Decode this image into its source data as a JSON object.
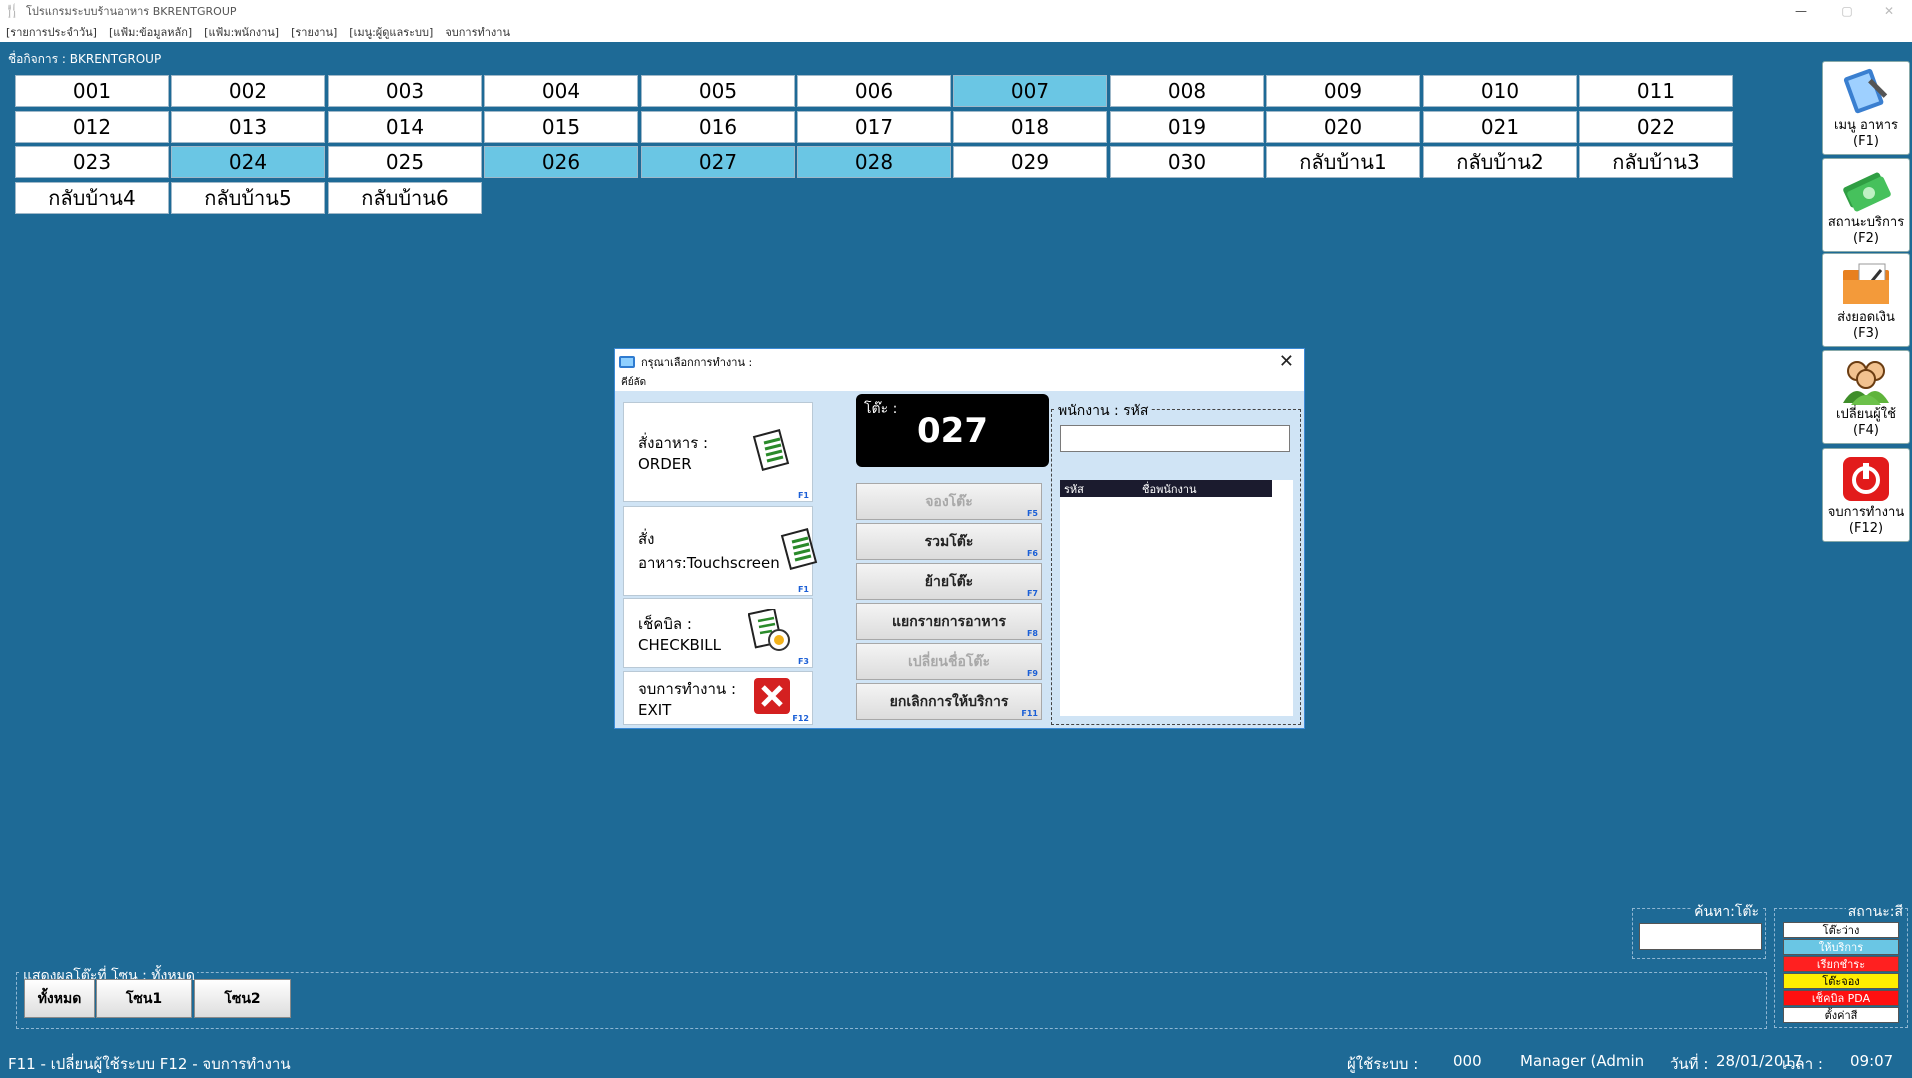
{
  "window": {
    "title": "โปรแกรมระบบร้านอาหาร  BKRENTGROUP",
    "menu": [
      "[รายการประจำวัน]",
      "[แฟ้ม:ข้อมูลหลัก]",
      "[แฟ้ม:พนักงาน]",
      "[รายงาน]",
      "[เมนู:ผู้ดูแลระบบ]",
      "จบการทำงาน"
    ]
  },
  "business_label": "ชื่อกิจการ :  BKRENTGROUP",
  "tables": [
    {
      "label": "001",
      "busy": false
    },
    {
      "label": "002",
      "busy": false
    },
    {
      "label": "003",
      "busy": false
    },
    {
      "label": "004",
      "busy": false
    },
    {
      "label": "005",
      "busy": false
    },
    {
      "label": "006",
      "busy": false
    },
    {
      "label": "007",
      "busy": true
    },
    {
      "label": "008",
      "busy": false
    },
    {
      "label": "009",
      "busy": false
    },
    {
      "label": "010",
      "busy": false
    },
    {
      "label": "011",
      "busy": false
    },
    {
      "label": "012",
      "busy": false
    },
    {
      "label": "013",
      "busy": false
    },
    {
      "label": "014",
      "busy": false
    },
    {
      "label": "015",
      "busy": false
    },
    {
      "label": "016",
      "busy": false
    },
    {
      "label": "017",
      "busy": false
    },
    {
      "label": "018",
      "busy": false
    },
    {
      "label": "019",
      "busy": false
    },
    {
      "label": "020",
      "busy": false
    },
    {
      "label": "021",
      "busy": false
    },
    {
      "label": "022",
      "busy": false
    },
    {
      "label": "023",
      "busy": false
    },
    {
      "label": "024",
      "busy": true
    },
    {
      "label": "025",
      "busy": false
    },
    {
      "label": "026",
      "busy": true
    },
    {
      "label": "027",
      "busy": true
    },
    {
      "label": "028",
      "busy": true
    },
    {
      "label": "029",
      "busy": false
    },
    {
      "label": "030",
      "busy": false
    },
    {
      "label": "กลับบ้าน1",
      "busy": false
    },
    {
      "label": "กลับบ้าน2",
      "busy": false
    },
    {
      "label": "กลับบ้าน3",
      "busy": false
    },
    {
      "label": "กลับบ้าน4",
      "busy": false
    },
    {
      "label": "กลับบ้าน5",
      "busy": false
    },
    {
      "label": "กลับบ้าน6",
      "busy": false
    }
  ],
  "sidebar": [
    {
      "line1": "เมนู อาหาร",
      "line2": "(F1)",
      "icon": "book-icon"
    },
    {
      "line1": "สถานะบริการ",
      "line2": "(F2)",
      "icon": "money-icon"
    },
    {
      "line1": "ส่งยอดเงิน",
      "line2": "(F3)",
      "icon": "folder-icon"
    },
    {
      "line1": "เปลี่ยนผู้ใช้",
      "line2": "(F4)",
      "icon": "users-icon"
    },
    {
      "line1": "จบการทำงาน",
      "line2": "(F12)",
      "icon": "power-icon"
    }
  ],
  "dialog": {
    "title": "กรุณาเลือกการทำงาน :",
    "menu": "คีย์ลัด",
    "actions": [
      {
        "label": "สั่งอาหาร : ORDER",
        "key": "F1",
        "icon": "order-icon"
      },
      {
        "label": "สั่งอาหาร:Touchscreen",
        "key": "F1",
        "icon": "touchscreen-order-icon"
      },
      {
        "label": "เช็คบิล : CHECKBILL",
        "key": "F3",
        "icon": "checkbill-icon"
      },
      {
        "label": "จบการทำงาน : EXIT",
        "key": "F12",
        "icon": "exit-icon"
      }
    ],
    "table_label": "โต๊ะ :",
    "table_number": "027",
    "mid_buttons": [
      {
        "label": "จองโต๊ะ",
        "key": "F5",
        "enabled": false
      },
      {
        "label": "รวมโต๊ะ",
        "key": "F6",
        "enabled": true
      },
      {
        "label": "ย้ายโต๊ะ",
        "key": "F7",
        "enabled": true
      },
      {
        "label": "แยกรายการอาหาร",
        "key": "F8",
        "enabled": true
      },
      {
        "label": "เปลี่ยนชื่อโต๊ะ",
        "key": "F9",
        "enabled": false
      },
      {
        "label": "ยกเลิกการให้บริการ",
        "key": "F11",
        "enabled": true
      }
    ],
    "staff_caption": "พนักงาน : รหัส",
    "staff_input_value": "",
    "staff_columns": [
      "รหัส",
      "ชื่อพนักงาน"
    ]
  },
  "search": {
    "caption": "ค้นหา:โต๊ะ",
    "value": ""
  },
  "status_legend": {
    "caption": "สถานะ:สี",
    "items": [
      {
        "label": "โต๊ะว่าง",
        "bg": "#ffffff",
        "fg": "#000000"
      },
      {
        "label": "ให้บริการ",
        "bg": "#6ac6e4",
        "fg": "#ffffff"
      },
      {
        "label": "เรียกชำระ",
        "bg": "#ff2020",
        "fg": "#ffffff"
      },
      {
        "label": "โต๊ะจอง",
        "bg": "#ffee00",
        "fg": "#000000"
      },
      {
        "label": "เช็คบิล PDA",
        "bg": "#ff1010",
        "fg": "#ffffff"
      },
      {
        "label": "ตั้งค่าสี",
        "bg": "#ffffff",
        "fg": "#000000"
      }
    ]
  },
  "zone": {
    "caption": "แสดงผลโต๊ะที่  โซน : ทั้งหมด",
    "buttons": [
      "ทั้งหมด",
      "โซน1",
      "โซน2"
    ]
  },
  "statusbar": {
    "shortcuts": "F11 - เปลี่ยนผู้ใช้ระบบ    F12 - จบการทำงาน",
    "user_label": "ผู้ใช้ระบบ :",
    "user_code": "000",
    "user_name": "Manager (Admin",
    "date_label": "วันที่ :",
    "date": "28/01/2017",
    "time_label": "เวลา :",
    "time": "09:07"
  }
}
